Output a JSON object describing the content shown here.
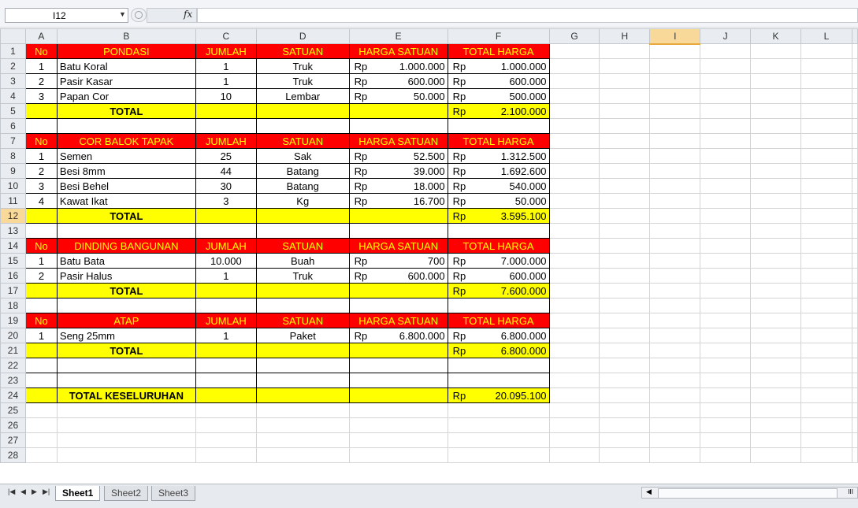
{
  "formula_bar": {
    "name_box": "I12",
    "fx_label": "fx",
    "formula": ""
  },
  "columns": [
    "A",
    "B",
    "C",
    "D",
    "E",
    "F",
    "G",
    "H",
    "I",
    "J",
    "K",
    "L"
  ],
  "active_cell": {
    "column": "I",
    "row": 12
  },
  "sections": [
    {
      "header": {
        "no": "No",
        "name": "PONDASI",
        "jumlah": "JUMLAH",
        "satuan": "SATUAN",
        "harga": "HARGA SATUAN",
        "total": "TOTAL HARGA"
      },
      "items": [
        {
          "no": "1",
          "name": "Batu Koral",
          "qty": "1",
          "unit": "Truk",
          "cur1": "Rp",
          "price": "1.000.000",
          "cur2": "Rp",
          "total": "1.000.000"
        },
        {
          "no": "2",
          "name": "Pasir Kasar",
          "qty": "1",
          "unit": "Truk",
          "cur1": "Rp",
          "price": "600.000",
          "cur2": "Rp",
          "total": "600.000"
        },
        {
          "no": "3",
          "name": "Papan Cor",
          "qty": "10",
          "unit": "Lembar",
          "cur1": "Rp",
          "price": "50.000",
          "cur2": "Rp",
          "total": "500.000"
        }
      ],
      "total": {
        "label": "TOTAL",
        "cur": "Rp",
        "value": "2.100.000"
      }
    },
    {
      "header": {
        "no": "No",
        "name": "COR BALOK TAPAK",
        "jumlah": "JUMLAH",
        "satuan": "SATUAN",
        "harga": "HARGA SATUAN",
        "total": "TOTAL HARGA"
      },
      "items": [
        {
          "no": "1",
          "name": "Semen",
          "qty": "25",
          "unit": "Sak",
          "cur1": "Rp",
          "price": "52.500",
          "cur2": "Rp",
          "total": "1.312.500"
        },
        {
          "no": "2",
          "name": "Besi 8mm",
          "qty": "44",
          "unit": "Batang",
          "cur1": "Rp",
          "price": "39.000",
          "cur2": "Rp",
          "total": "1.692.600"
        },
        {
          "no": "3",
          "name": "Besi Behel",
          "qty": "30",
          "unit": "Batang",
          "cur1": "Rp",
          "price": "18.000",
          "cur2": "Rp",
          "total": "540.000"
        },
        {
          "no": "4",
          "name": "Kawat Ikat",
          "qty": "3",
          "unit": "Kg",
          "cur1": "Rp",
          "price": "16.700",
          "cur2": "Rp",
          "total": "50.000"
        }
      ],
      "total": {
        "label": "TOTAL",
        "cur": "Rp",
        "value": "3.595.100"
      }
    },
    {
      "header": {
        "no": "No",
        "name": "DINDING BANGUNAN",
        "jumlah": "JUMLAH",
        "satuan": "SATUAN",
        "harga": "HARGA SATUAN",
        "total": "TOTAL HARGA"
      },
      "items": [
        {
          "no": "1",
          "name": "Batu Bata",
          "qty": "10.000",
          "unit": "Buah",
          "cur1": "Rp",
          "price": "700",
          "cur2": "Rp",
          "total": "7.000.000"
        },
        {
          "no": "2",
          "name": "Pasir Halus",
          "qty": "1",
          "unit": "Truk",
          "cur1": "Rp",
          "price": "600.000",
          "cur2": "Rp",
          "total": "600.000"
        }
      ],
      "total": {
        "label": "TOTAL",
        "cur": "Rp",
        "value": "7.600.000"
      }
    },
    {
      "header": {
        "no": "No",
        "name": "ATAP",
        "jumlah": "JUMLAH",
        "satuan": "SATUAN",
        "harga": "HARGA SATUAN",
        "total": "TOTAL HARGA"
      },
      "items": [
        {
          "no": "1",
          "name": "Seng 25mm",
          "qty": "1",
          "unit": "Paket",
          "cur1": "Rp",
          "price": "6.800.000",
          "cur2": "Rp",
          "total": "6.800.000"
        }
      ],
      "total": {
        "label": "TOTAL",
        "cur": "Rp",
        "value": "6.800.000"
      }
    }
  ],
  "grand_total": {
    "label": "TOTAL KESELURUHAN",
    "cur": "Rp",
    "value": "20.095.100"
  },
  "sheet_tabs": [
    "Sheet1",
    "Sheet2",
    "Sheet3"
  ],
  "active_sheet": "Sheet1",
  "colors": {
    "header_fill": "#ff0000",
    "header_text": "#ffff00",
    "total_fill": "#ffff00",
    "active_header": "#f9d99a"
  }
}
